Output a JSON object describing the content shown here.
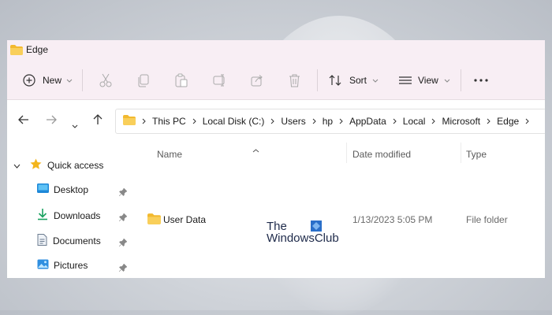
{
  "window": {
    "title": "Edge"
  },
  "toolbar": {
    "new_label": "New",
    "sort_label": "Sort",
    "view_label": "View",
    "buttons": [
      "cut-icon",
      "copy-icon",
      "paste-icon",
      "rename-icon",
      "share-icon",
      "delete-icon",
      "more-icon"
    ]
  },
  "address": {
    "crumbs": [
      "This PC",
      "Local Disk (C:)",
      "Users",
      "hp",
      "AppData",
      "Local",
      "Microsoft",
      "Edge"
    ]
  },
  "navigation": {
    "quick_access_label": "Quick access",
    "items": [
      {
        "label": "Desktop",
        "icon": "desktop-icon"
      },
      {
        "label": "Downloads",
        "icon": "downloads-icon"
      },
      {
        "label": "Documents",
        "icon": "documents-icon"
      },
      {
        "label": "Pictures",
        "icon": "pictures-icon"
      }
    ]
  },
  "files": {
    "columns": {
      "name": "Name",
      "date": "Date modified",
      "type": "Type"
    },
    "rows": [
      {
        "name": "User Data",
        "date": "1/13/2023 5:05 PM",
        "type": "File folder"
      }
    ]
  },
  "watermark": {
    "line1": "The",
    "line2": "WindowsClub"
  },
  "colors": {
    "accent": "#0067c0",
    "folder": "#f7c948",
    "titlebar": "#f8eef4"
  }
}
